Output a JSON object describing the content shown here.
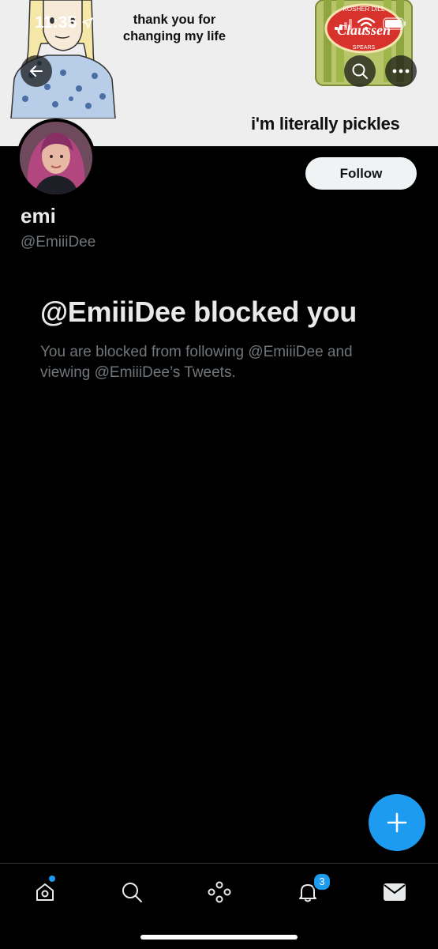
{
  "status_bar": {
    "time": "11:35"
  },
  "banner": {
    "meme_top_text": "thank you for changing my life",
    "meme_bottom_text": "i'm literally pickles",
    "jar_brand": "Claussen",
    "jar_top": "KOSHER DILL",
    "jar_sub": "SPEARS"
  },
  "profile": {
    "display_name": "emi",
    "handle": "@EmiiiDee",
    "follow_label": "Follow"
  },
  "blocked": {
    "title": "@EmiiiDee blocked you",
    "description": "You are blocked from following @EmiiiDee and viewing @EmiiiDee’s Tweets."
  },
  "bottom_nav": {
    "items": [
      {
        "name": "home",
        "icon": "home-icon"
      },
      {
        "name": "search",
        "icon": "search-icon"
      },
      {
        "name": "spaces",
        "icon": "spaces-icon"
      },
      {
        "name": "notifications",
        "icon": "bell-icon"
      },
      {
        "name": "messages",
        "icon": "envelope-icon"
      }
    ],
    "notification_count": "3"
  },
  "colors": {
    "accent": "#1d9bf0",
    "background": "#000000",
    "secondary_text": "#71767b"
  }
}
